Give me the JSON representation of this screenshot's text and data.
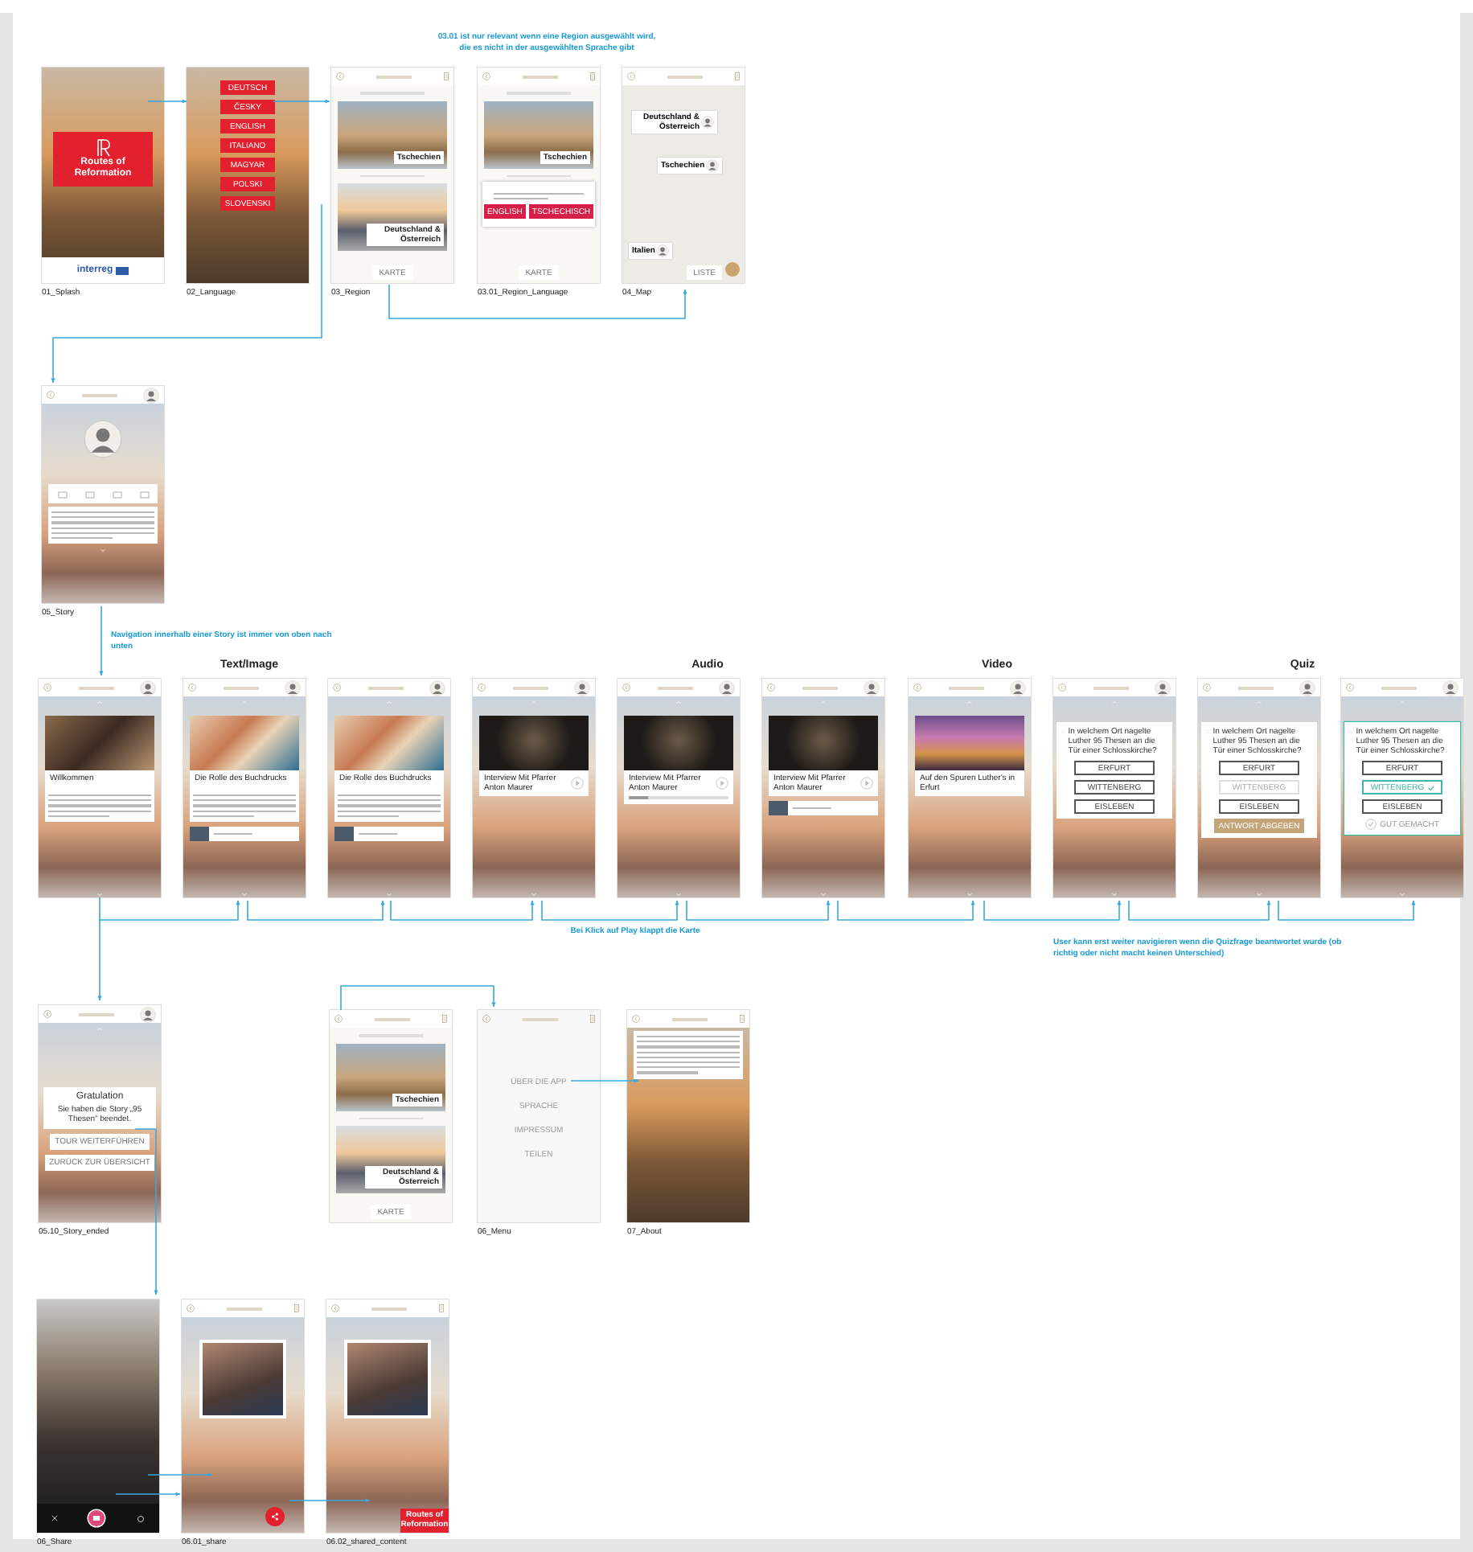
{
  "notes": [
    {
      "text": "03.01 ist nur relevant wenn eine Region ausgewählt wird, die es nicht in der ausgewählten Sprache gibt"
    },
    {
      "text": "Navigation innerhalb einer Story ist immer von oben nach unten"
    },
    {
      "text": "Bei Klick auf Play klappt die Karte"
    },
    {
      "text": "User kann erst weiter navigieren wenn die Quizfrage beantwortet wurde (ob richtig oder nicht macht keinen Unterschied)"
    }
  ],
  "sections": [
    "Text/Image",
    "Audio",
    "Video",
    "Quiz"
  ],
  "screens": [
    {
      "kind": "splash",
      "label": "01_Splash",
      "title": "Routes of Reformation",
      "sponsor": "interreg"
    },
    {
      "kind": "language",
      "label": "02_Language",
      "options": [
        "DEUTSCH",
        "ČESKY",
        "ENGLISH",
        "ITALIANO",
        "MAGYAR",
        "POLSKI",
        "SLOVENSKI"
      ]
    },
    {
      "kind": "region",
      "label": "03_Region",
      "cards": [
        {
          "title": "Tschechien"
        },
        {
          "title": "Deutschland & Österreich"
        }
      ],
      "button": "KARTE"
    },
    {
      "kind": "region",
      "label": "03.01_Region_Language",
      "cards": [
        {
          "title": "Tschechien"
        }
      ],
      "dialog": {
        "buttons": [
          "ENGLISH",
          "TSCHECHISCH"
        ]
      },
      "button": "KARTE"
    },
    {
      "kind": "map",
      "label": "04_Map",
      "pins": [
        {
          "title": "Deutschland & Österreich"
        },
        {
          "title": "Tschechien"
        },
        {
          "title": "Italien"
        }
      ],
      "button": "LISTE"
    },
    {
      "kind": "story",
      "label": "05_Story"
    },
    {
      "kind": "card",
      "media": {
        "kind": "painting"
      },
      "title": "Willkommen",
      "text": true
    },
    {
      "kind": "card",
      "media": {
        "kind": "manuscript"
      },
      "title": "Die Rolle des Buchdrucks",
      "text": true,
      "footer": true
    },
    {
      "kind": "card",
      "media": {
        "kind": "manuscript"
      },
      "title": "Die Rolle des Buchdrucks",
      "text": true,
      "footer": true
    },
    {
      "kind": "card",
      "media": {
        "kind": "portrait"
      },
      "title": "Interview Mit Pfarrer Anton Maurer",
      "play": true
    },
    {
      "kind": "card",
      "media": {
        "kind": "portrait"
      },
      "title": "Interview Mit Pfarrer Anton Maurer",
      "play": true,
      "level": 0.2
    },
    {
      "kind": "card",
      "media": {
        "kind": "portrait"
      },
      "title": "Interview Mit Pfarrer Anton Maurer",
      "play": true,
      "footer": true
    },
    {
      "kind": "card",
      "media": {
        "kind": "city"
      },
      "title": "Auf den Spuren Luther's in Erfurt"
    },
    {
      "kind": "quiz",
      "question": "In welchem Ort nagelte Luther 95 Thesen an die Tür einer Schlosskirche?",
      "answered": false,
      "options": [
        {
          "text": "ERFURT",
          "selected": false
        },
        {
          "text": "WITTENBERG",
          "selected": false
        },
        {
          "text": "EISLEBEN",
          "selected": false
        }
      ]
    },
    {
      "kind": "quiz",
      "question": "In welchem Ort nagelte Luther 95 Thesen an die Tür einer Schlosskirche?",
      "answered": false,
      "options": [
        {
          "text": "ERFURT",
          "selected": false
        },
        {
          "text": "WITTENBERG",
          "selected": true
        },
        {
          "text": "EISLEBEN",
          "selected": false
        }
      ],
      "submit": "ANTWORT ABGEBEN"
    },
    {
      "kind": "quiz",
      "question": "In welchem Ort nagelte Luther 95 Thesen an die Tür einer Schlosskirche?",
      "answered": true,
      "options": [
        {
          "text": "ERFURT",
          "selected": false
        },
        {
          "text": "WITTENBERG",
          "selected": true
        },
        {
          "text": "EISLEBEN",
          "selected": false
        }
      ],
      "feedback": "GUT GEMACHT"
    },
    {
      "kind": "ended",
      "label": "05.10_Story_ended",
      "title": "Gratulation",
      "text": "Sie haben die Story „95 Thesen“ beendet.",
      "buttons": [
        "TOUR WEITERFÜHREN",
        "ZURÜCK ZUR ÜBERSICHT"
      ]
    },
    {
      "kind": "region",
      "cards": [
        {
          "title": "Tschechien"
        },
        {
          "title": "Deutschland & Österreich"
        }
      ],
      "button": "KARTE"
    },
    {
      "kind": "menu",
      "label": "06_Menu",
      "items": [
        "ÜBER DIE APP",
        "SPRACHE",
        "IMPRESSUM",
        "TEILEN"
      ]
    },
    {
      "kind": "about",
      "label": "07_About"
    },
    {
      "kind": "camera",
      "label": "06_Share"
    },
    {
      "kind": "share",
      "label": "06.01_share",
      "shared": false
    },
    {
      "kind": "share",
      "label": "06.02_shared_content",
      "shared": true,
      "logo": "Routes of Reformation"
    }
  ]
}
